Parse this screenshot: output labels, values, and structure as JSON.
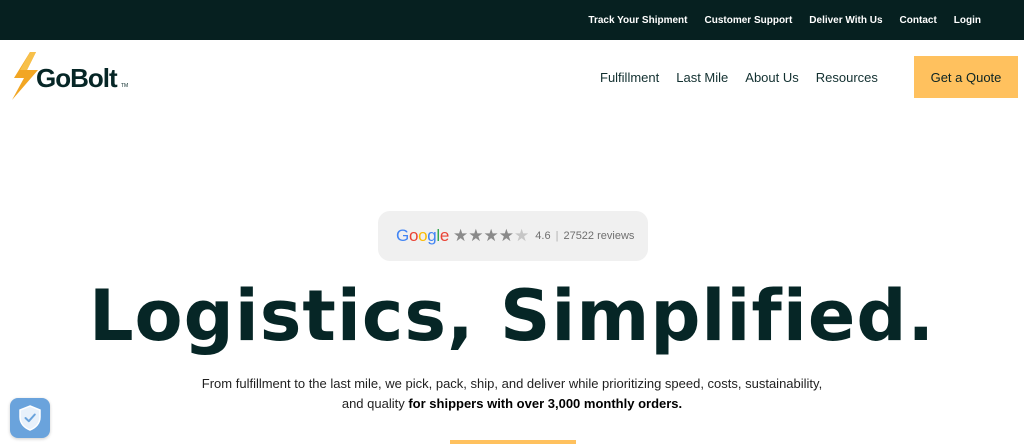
{
  "topbar": {
    "links": [
      "Track Your Shipment",
      "Customer Support",
      "Deliver With Us",
      "Contact",
      "Login"
    ]
  },
  "logo": {
    "text": "GoBolt",
    "trademark": "TM"
  },
  "nav": {
    "items": [
      "Fulfillment",
      "Last Mile",
      "About Us",
      "Resources"
    ],
    "cta": "Get a Quote"
  },
  "review": {
    "provider": "Google",
    "rating": "4.6",
    "rating_value": 4.6,
    "reviews": "27522 reviews"
  },
  "hero": {
    "title": "Logistics, Simplified.",
    "subtitle_line1": "From fulfillment to the last mile, we pick, pack, ship, and deliver while prioritizing speed, costs, sustainability,",
    "subtitle_line2_plain": "and quality ",
    "subtitle_line2_bold": "for shippers with over 3,000 monthly orders."
  },
  "colors": {
    "topbar_bg": "#062020",
    "accent": "#ffc15e",
    "heading": "#062626",
    "badge_bg": "#f0f0f0"
  },
  "icons": [
    "bolt-icon",
    "star-icon",
    "shield-check-icon"
  ]
}
